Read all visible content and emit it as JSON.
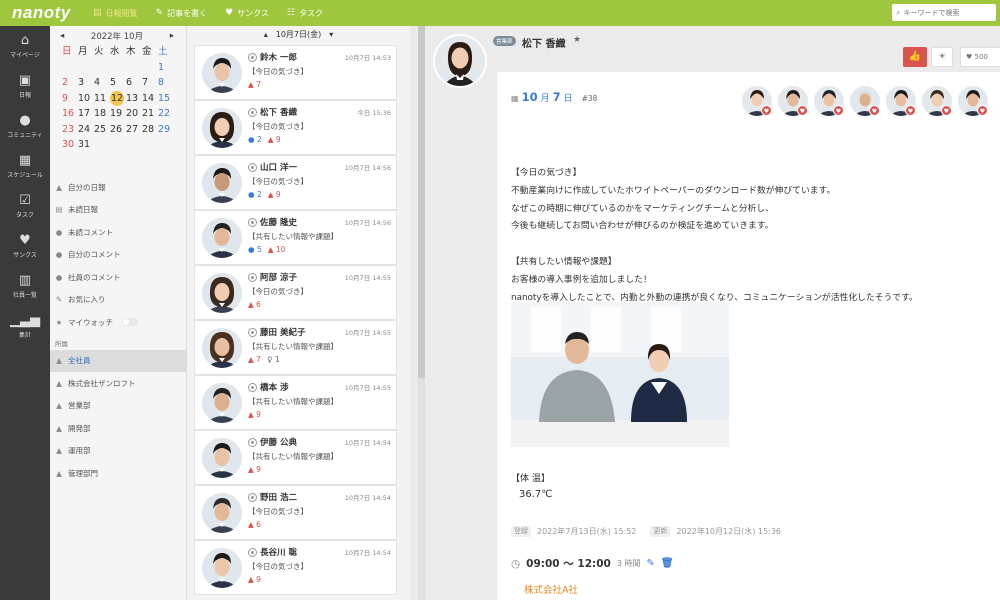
{
  "app": {
    "logo": "nanoty"
  },
  "topnav": [
    {
      "label": "日報閲覧",
      "icon": "book-icon",
      "active": true
    },
    {
      "label": "記事を書く",
      "icon": "pencil-icon",
      "active": false
    },
    {
      "label": "サンクス",
      "icon": "heart-icon",
      "active": false
    },
    {
      "label": "タスク",
      "icon": "task-icon",
      "active": false
    }
  ],
  "search": {
    "placeholder": "キーワードで検索"
  },
  "leftnav": [
    {
      "label": "マイページ",
      "icon": "home-icon"
    },
    {
      "label": "日報",
      "icon": "report-icon"
    },
    {
      "label": "コミュニティ",
      "icon": "community-icon"
    },
    {
      "label": "スケジュール",
      "icon": "calendar-icon"
    },
    {
      "label": "タスク",
      "icon": "task-icon"
    },
    {
      "label": "サンクス",
      "icon": "heart-icon"
    },
    {
      "label": "社員一覧",
      "icon": "people-icon"
    },
    {
      "label": "集計",
      "icon": "chart-icon"
    }
  ],
  "calendar": {
    "title": "2022年 10月",
    "weekdays": [
      "日",
      "月",
      "火",
      "水",
      "木",
      "金",
      "土"
    ],
    "days": [
      "",
      "",
      "",
      "",
      "",
      "",
      "1",
      "2",
      "3",
      "4",
      "5",
      "6",
      "7",
      "8",
      "9",
      "10",
      "11",
      "12",
      "13",
      "14",
      "15",
      "16",
      "17",
      "18",
      "19",
      "20",
      "21",
      "22",
      "23",
      "24",
      "25",
      "26",
      "27",
      "28",
      "29",
      "30",
      "31",
      "",
      "",
      "",
      "",
      ""
    ],
    "today": "12"
  },
  "menu": {
    "items": [
      {
        "label": "自分の日報",
        "icon": "person-icon"
      },
      {
        "label": "未読日報",
        "icon": "doc-icon"
      },
      {
        "label": "未読コメント",
        "icon": "comment-icon"
      },
      {
        "label": "自分のコメント",
        "icon": "comment-icon"
      },
      {
        "label": "社員のコメント",
        "icon": "comment-icon"
      },
      {
        "label": "お気に入り",
        "icon": "pin-icon"
      },
      {
        "label": "マイウォッチ",
        "icon": "star-icon"
      }
    ],
    "section_label": "所属",
    "groups": [
      {
        "label": "全社員",
        "active": true
      },
      {
        "label": "株式会社ザンロフト",
        "active": false
      },
      {
        "label": "営業部",
        "active": false
      },
      {
        "label": "開発部",
        "active": false
      },
      {
        "label": "運用部",
        "active": false
      },
      {
        "label": "管理部門",
        "active": false
      }
    ]
  },
  "list": {
    "date": "10月7日(金)",
    "reports": [
      {
        "name": "鈴木 一郎",
        "time": "10月7日 14:53",
        "category": "【今日の気づき】",
        "comments": "",
        "likes": "7",
        "watch": ""
      },
      {
        "name": "松下 香織",
        "time": "今日 15:36",
        "category": "【今日の気づき】",
        "comments": "2",
        "likes": "9",
        "watch": ""
      },
      {
        "name": "山口 洋一",
        "time": "10月7日 14:56",
        "category": "【今日の気づき】",
        "comments": "2",
        "likes": "9",
        "watch": ""
      },
      {
        "name": "佐藤 隆史",
        "time": "10月7日 14:56",
        "category": "【共有したい情報や課題】",
        "comments": "5",
        "likes": "10",
        "watch": ""
      },
      {
        "name": "阿部 涼子",
        "time": "10月7日 14:55",
        "category": "【今日の気づき】",
        "comments": "",
        "likes": "6",
        "watch": ""
      },
      {
        "name": "藤田 美紀子",
        "time": "10月7日 14:55",
        "category": "【共有したい情報や課題】",
        "comments": "",
        "likes": "7",
        "watch": "1"
      },
      {
        "name": "橋本 渉",
        "time": "10月7日 14:55",
        "category": "【共有したい情報や課題】",
        "comments": "",
        "likes": "9",
        "watch": ""
      },
      {
        "name": "伊藤 公典",
        "time": "10月7日 14:54",
        "category": "【共有したい情報や課題】",
        "comments": "",
        "likes": "9",
        "watch": ""
      },
      {
        "name": "野田 浩二",
        "time": "10月7日 14:54",
        "category": "【今日の気づき】",
        "comments": "",
        "likes": "6",
        "watch": ""
      },
      {
        "name": "長谷川 聡",
        "time": "10月7日 14:54",
        "category": "【今日の気づき】",
        "comments": "",
        "likes": "9",
        "watch": ""
      }
    ]
  },
  "report": {
    "badge": "営業部",
    "author": "松下 香織",
    "star": "★",
    "thanks_count": "500",
    "date_month": "10",
    "date_month_unit": "月",
    "date_day": "7",
    "date_day_unit": "日",
    "number": "#38",
    "likers_count": 7,
    "body": [
      "【今日の気づき】",
      "不動産業向けに作成していたホワイトペーパーのダウンロード数が伸びています。",
      "なぜこの時期に伸びているのかをマーケティングチームと分析し、",
      "今後も継続してお問い合わせが伸びるのか検証を進めていきます。",
      "",
      "【共有したい情報や課題】",
      "お客様の導入事例を追加しました！",
      "nanotyを導入したことで、内勤と外勤の連携が良くなり、コミュニケーションが活性化したそうです。"
    ],
    "temp_label": "【体 温】",
    "temp_value": "36.7℃",
    "created_label": "登録",
    "created": "2022年7月13日(水) 15:52",
    "updated_label": "更新",
    "updated": "2022年10月12日(水) 15:36"
  },
  "schedule": {
    "time": "09:00 ～ 12:00",
    "duration": "3 時間",
    "company": "株式会社A社"
  },
  "colors": {
    "brand": "#9ec73d",
    "like": "#d9534f",
    "link": "#3a7bd5"
  }
}
